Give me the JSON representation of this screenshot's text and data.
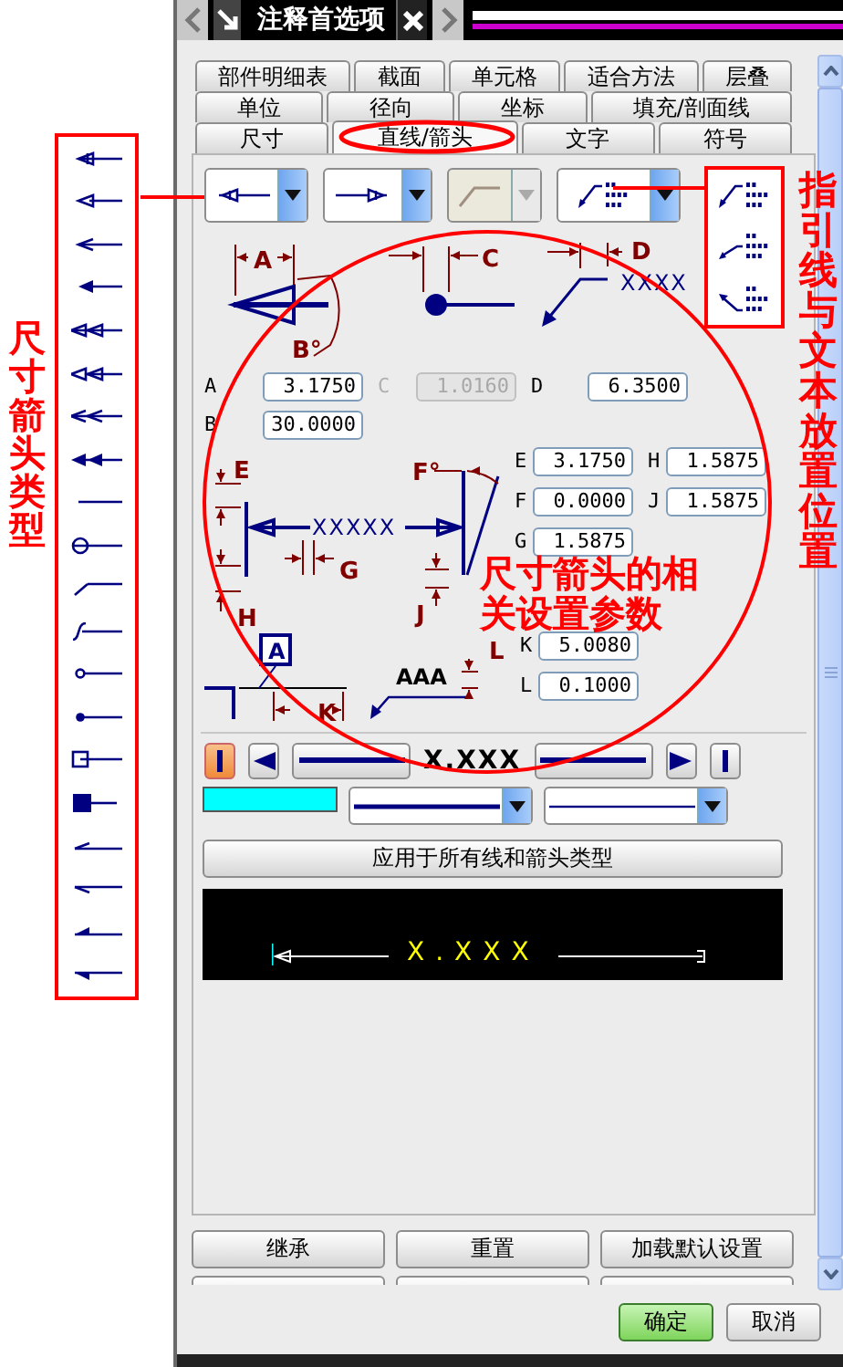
{
  "window": {
    "title": "注释首选项"
  },
  "tab_rows": [
    [
      {
        "label": "部件明细表",
        "selected": false
      },
      {
        "label": "截面",
        "selected": false
      },
      {
        "label": "单元格",
        "selected": false
      },
      {
        "label": "适合方法",
        "selected": false
      },
      {
        "label": "层叠",
        "selected": false
      }
    ],
    [
      {
        "label": "单位",
        "selected": false
      },
      {
        "label": "径向",
        "selected": false
      },
      {
        "label": "坐标",
        "selected": false
      },
      {
        "label": "填充/剖面线",
        "selected": false
      }
    ],
    [
      {
        "label": "尺寸",
        "selected": false
      },
      {
        "label": "直线/箭头",
        "selected": true
      },
      {
        "label": "文字",
        "selected": false
      },
      {
        "label": "符号",
        "selected": false
      }
    ]
  ],
  "dropdowns": [
    {
      "kind": "arrow-left",
      "disabled": false
    },
    {
      "kind": "arrow-right",
      "disabled": false
    },
    {
      "kind": "jog",
      "disabled": true
    },
    {
      "kind": "leader-text",
      "disabled": false
    }
  ],
  "diagram_labels": [
    {
      "text": "A",
      "kind": "dimension"
    },
    {
      "text": "B°",
      "kind": "dimension"
    },
    {
      "text": "C",
      "kind": "dimension"
    },
    {
      "text": "D",
      "kind": "dimension"
    },
    {
      "text": "XXXX",
      "kind": "sample"
    },
    {
      "text": "E",
      "kind": "dimension"
    },
    {
      "text": "F°",
      "kind": "dimension"
    },
    {
      "text": "XXXXX",
      "kind": "sample"
    },
    {
      "text": "G",
      "kind": "dimension"
    },
    {
      "text": "H",
      "kind": "dimension"
    },
    {
      "text": "J",
      "kind": "dimension"
    },
    {
      "text": "A",
      "kind": "boxed"
    },
    {
      "text": "AAA",
      "kind": "text"
    },
    {
      "text": "L",
      "kind": "dimension"
    },
    {
      "text": "K",
      "kind": "dimension"
    }
  ],
  "parameters": [
    {
      "label": "A",
      "value": "3.1750",
      "disabled": false
    },
    {
      "label": "C",
      "value": "1.0160",
      "disabled": true
    },
    {
      "label": "D",
      "value": "6.3500",
      "disabled": false
    },
    {
      "label": "B",
      "value": "30.0000",
      "disabled": false
    },
    {
      "label": "E",
      "value": "3.1750",
      "disabled": false
    },
    {
      "label": "H",
      "value": "1.5875",
      "disabled": false
    },
    {
      "label": "F",
      "value": "0.0000",
      "disabled": false
    },
    {
      "label": "J",
      "value": "1.5875",
      "disabled": false
    },
    {
      "label": "G",
      "value": "1.5875",
      "disabled": false
    },
    {
      "label": "K",
      "value": "5.0080",
      "disabled": false
    },
    {
      "label": "L",
      "value": "0.1000",
      "disabled": false
    }
  ],
  "line_controls": [
    {
      "kind": "extension",
      "selected": true
    },
    {
      "kind": "arrow-left",
      "selected": false
    },
    {
      "kind": "line"
    },
    {
      "kind": "text",
      "text": "X.XXX"
    },
    {
      "kind": "line"
    },
    {
      "kind": "arrow-right",
      "selected": false
    },
    {
      "kind": "extension",
      "selected": false
    }
  ],
  "line_color": {
    "color": "#00ffff"
  },
  "line_styles": [
    {
      "kind": "thick"
    },
    {
      "kind": "thin"
    }
  ],
  "apply_button": "应用于所有线和箭头类型",
  "preview": {
    "text": "X.XXX"
  },
  "buttons": [
    {
      "label": "继承"
    },
    {
      "label": "重置"
    },
    {
      "label": "加载默认设置"
    }
  ],
  "dialog_buttons": [
    {
      "label": "确定",
      "default": true
    },
    {
      "label": "取消",
      "default": false
    }
  ],
  "annotations": [
    {
      "text": "尺寸箭头类型"
    },
    {
      "text": "指引线与文本放置位置"
    },
    {
      "text": "尺寸箭头的相关设置参数"
    }
  ]
}
